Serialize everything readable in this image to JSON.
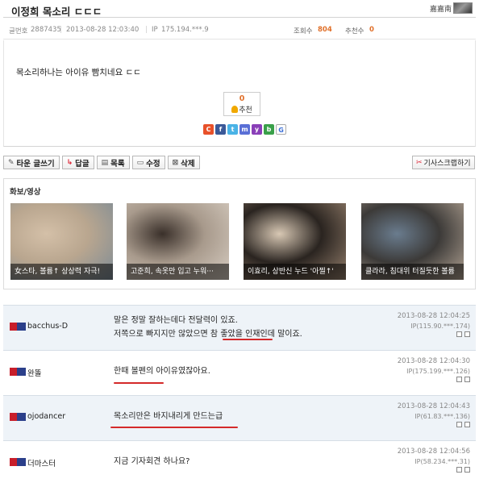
{
  "post": {
    "title": "이정희 목소리 ㄷㄷㄷ",
    "author_name": "嘉嘉南",
    "number_label": "글번호",
    "number": "2887435",
    "date": "2013-08-28 12:03:40",
    "ip_label": "IP",
    "ip": "175.194.***.9",
    "views_label": "조회수",
    "views": "804",
    "recommends_label": "추천수",
    "recommends": "0",
    "content": "목소리하나는 아이유 빰치네요 ㄷㄷ",
    "recommend_box": {
      "count": "0",
      "label": "추천"
    },
    "share_buttons": [
      {
        "icon": "c-share-icon",
        "label": "C",
        "color": "#e8512a"
      },
      {
        "icon": "facebook-icon",
        "label": "f",
        "color": "#3b5998"
      },
      {
        "icon": "twitter-icon",
        "label": "t",
        "color": "#4ab3e6"
      },
      {
        "icon": "me2day-icon",
        "label": "m",
        "color": "#5a6fd6"
      },
      {
        "icon": "yozm-icon",
        "label": "y",
        "color": "#8a3fb8"
      },
      {
        "icon": "band-icon",
        "label": "b",
        "color": "#3aa04a"
      },
      {
        "icon": "google-icon",
        "label": "G",
        "color": "#ffffff"
      }
    ]
  },
  "toolbar": {
    "write": "타운 글쓰기",
    "reply": "답글",
    "list": "목록",
    "edit": "수정",
    "delete": "삭제",
    "scrap": "기사스크랩하기"
  },
  "media": {
    "title": "화보/영상",
    "items": [
      {
        "caption": "女스타, 볼륨↑ 상상력 자극!",
        "palette": [
          "#b9a68f",
          "#7a8a96",
          "#d4c0a8"
        ]
      },
      {
        "caption": "고준희, 속옷만 입고 누워···",
        "palette": [
          "#a89a8c",
          "#d9cfc4",
          "#3a302a"
        ]
      },
      {
        "caption": "이효리, 상반신 누드 '아찔↑'",
        "palette": [
          "#2a2420",
          "#9a8470",
          "#d8c8b4"
        ]
      },
      {
        "caption": "클라라, 침대위 터질듯한 볼륨",
        "palette": [
          "#3c3a38",
          "#b8a898",
          "#6a7c8e"
        ]
      }
    ]
  },
  "comments": [
    {
      "author": "bacchus-D",
      "lines": [
        "말은 정말 잘하는데다 전달력이 있죠.",
        "저쪽으로 빠지지만 않았으면 참 좋았을 인재인데 말이죠."
      ],
      "date": "2013-08-28 12:04:25",
      "ip": "IP(115.90.***.174)"
    },
    {
      "author": "완똘",
      "lines": [
        "한때 볼펜의 아이유였잖아요."
      ],
      "date": "2013-08-28 12:04:30",
      "ip": "IP(175.199.***.126)"
    },
    {
      "author": "ojodancer",
      "lines": [
        "목소리만은 바지내리게 만드는급"
      ],
      "date": "2013-08-28 12:04:43",
      "ip": "IP(61.83.***.136)"
    },
    {
      "author": "더마스터",
      "lines": [
        "지금 기자회견 하나요?"
      ],
      "date": "2013-08-28 12:04:56",
      "ip": "IP(58.234.***.31)"
    }
  ]
}
